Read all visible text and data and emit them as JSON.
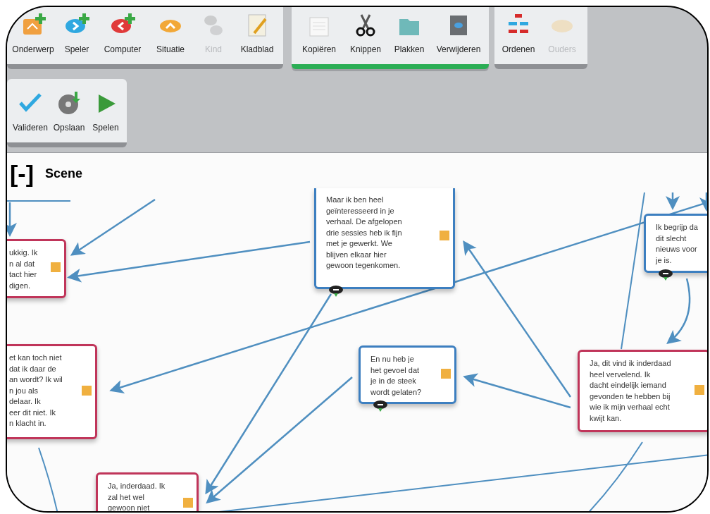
{
  "toolbar": {
    "groups": [
      {
        "selected": false,
        "buttons": [
          {
            "label": "Onderwerp",
            "disabled": false
          },
          {
            "label": "Speler",
            "disabled": false
          },
          {
            "label": "Computer",
            "disabled": false
          },
          {
            "label": "Situatie",
            "disabled": false
          },
          {
            "label": "Kind",
            "disabled": true
          },
          {
            "label": "Kladblad",
            "disabled": false
          }
        ]
      },
      {
        "selected": true,
        "buttons": [
          {
            "label": "Kopiëren",
            "disabled": false
          },
          {
            "label": "Knippen",
            "disabled": false
          },
          {
            "label": "Plakken",
            "disabled": false
          },
          {
            "label": "Verwijderen",
            "disabled": false
          }
        ]
      },
      {
        "selected": false,
        "buttons": [
          {
            "label": "Ordenen",
            "disabled": false
          },
          {
            "label": "Ouders",
            "disabled": true
          }
        ]
      },
      {
        "selected": false,
        "buttons": [
          {
            "label": "Valideren",
            "disabled": false
          },
          {
            "label": "Opslaan",
            "disabled": false
          },
          {
            "label": "Spelen",
            "disabled": false
          }
        ]
      }
    ]
  },
  "canvas": {
    "collapse_toggle": "[-]",
    "title": "Scene",
    "nodes": [
      {
        "kind": "player",
        "text": "ukkig. Ik\nn al dat\ntact hier\ndigen."
      },
      {
        "kind": "player",
        "text": "et kan toch niet\ndat ik daar de\nan wordt? Ik wil\nn jou als\ndelaar. Ik\neer dit niet. Ik\nn klacht in."
      },
      {
        "kind": "computer",
        "text": "Maar ik ben heel\ngeïnteresseerd in je\nverhaal. De afgelopen\ndrie sessies heb ik fijn\nmet je gewerkt. We\nblijven elkaar hier\ngewoon tegenkomen."
      },
      {
        "kind": "computer",
        "text": "En nu heb je\nhet gevoel dat\nje in de steek\nwordt gelaten?"
      },
      {
        "kind": "computer",
        "text": "Ik begrijp da\ndit slecht\nnieuws voor\nje is."
      },
      {
        "kind": "player",
        "text": "Ja, dit vind ik inderdaad\nheel vervelend. Ik\ndacht eindelijk iemand\ngevonden te hebben bij\nwie ik mijn verhaal echt\nkwijt kan."
      },
      {
        "kind": "player",
        "text": "Ja, inderdaad. Ik\nzal het wel\ngewoon niet"
      }
    ]
  }
}
